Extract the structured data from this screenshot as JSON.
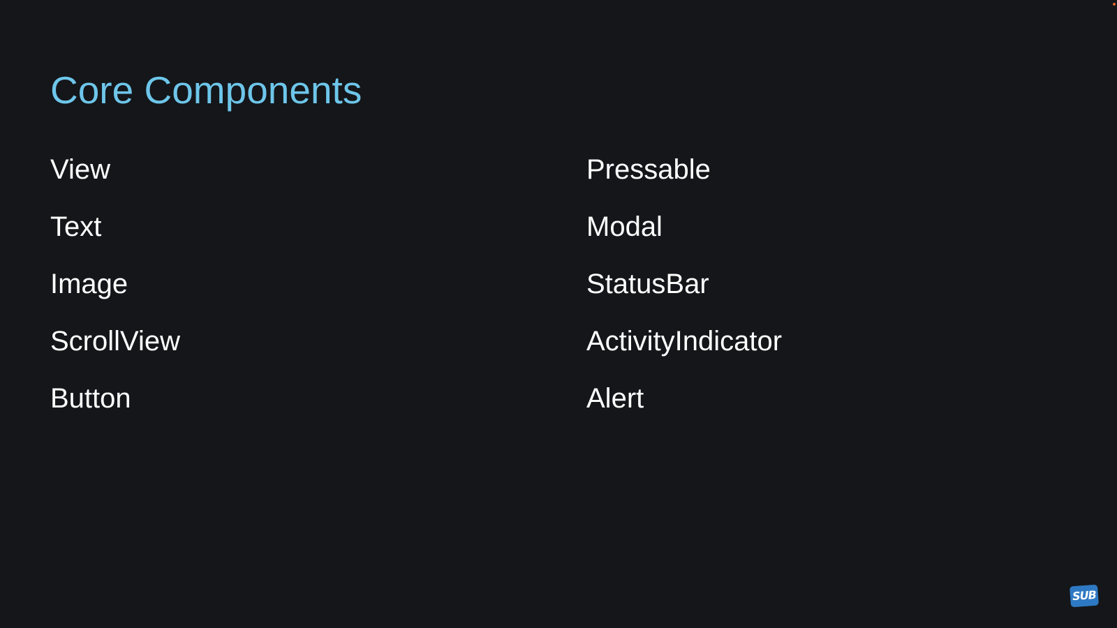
{
  "slide": {
    "title": "Core Components",
    "left_column": [
      "View",
      "Text",
      "Image",
      "ScrollView",
      "Button"
    ],
    "right_column": [
      "Pressable",
      "Modal",
      "StatusBar",
      "ActivityIndicator",
      "Alert"
    ]
  },
  "badge": {
    "label": "SUB",
    "icon": "subscribe-badge-icon"
  },
  "colors": {
    "background": "#14161a",
    "title": "#6ec6ea",
    "text": "#ffffff",
    "badge": "#2e79c3"
  }
}
